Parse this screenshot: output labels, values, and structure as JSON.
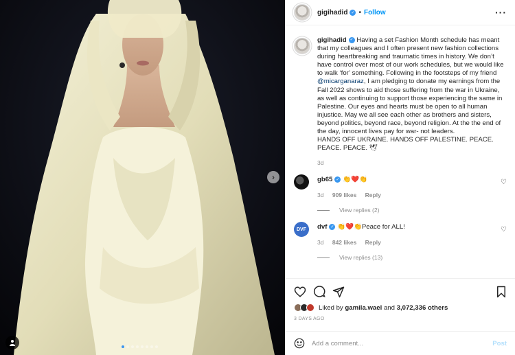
{
  "header": {
    "username": "gigihadid",
    "separator": "•",
    "follow_label": "Follow",
    "more_icon": "more-horizontal-icon"
  },
  "caption": {
    "username": "gigihadid",
    "text_before_mention": "Having a set Fashion Month schedule has meant that my colleagues and I often present new fashion collections during heartbreaking and traumatic times in history. We don’t have control over most of our work schedules, but we would like to walk ‘for’ something. Following in the footsteps of my friend",
    "mention": "@micarganaraz",
    "text_after_mention": ", I am pledging to donate my earnings from the Fall 2022 shows to aid those suffering from the war in Ukraine, as well as continuing to support those experiencing the same in Palestine. Our eyes and hearts must be open to all human injustice. May we all see each other as brothers and sisters, beyond politics, beyond race, beyond religion. At the the end of the day, innocent lives pay for war- not leaders.",
    "closing": "HANDS OFF UKRAINE. HANDS OFF PALESTINE. PEACE. PEACE. PEACE. 🕊",
    "age": "3d"
  },
  "comments": [
    {
      "username": "gb65",
      "text": "👏❤️👏",
      "age": "3d",
      "likes": "909 likes",
      "reply_label": "Reply",
      "view_replies": "View replies (2)"
    },
    {
      "username": "dvf",
      "avatar_text": "DVF",
      "text": "👏❤️👏Peace for ALL!",
      "age": "3d",
      "likes": "842 likes",
      "reply_label": "Reply",
      "view_replies": "View replies (13)"
    }
  ],
  "actions": {
    "icons": [
      "heart-icon",
      "comment-icon",
      "share-icon",
      "bookmark-icon"
    ]
  },
  "likes": {
    "prefix": "Liked by",
    "user": "gamila.wael",
    "conjunction": "and",
    "others": "3,072,336 others"
  },
  "timestamp": "3 DAYS AGO",
  "add_comment": {
    "placeholder": "Add a comment...",
    "post_label": "Post"
  },
  "carousel": {
    "count": 8,
    "active_index": 0
  },
  "colors": {
    "accent": "#0095f6",
    "verified": "#3897f0",
    "post_disabled": "#b2dffc",
    "muted": "#8e8e8e"
  }
}
